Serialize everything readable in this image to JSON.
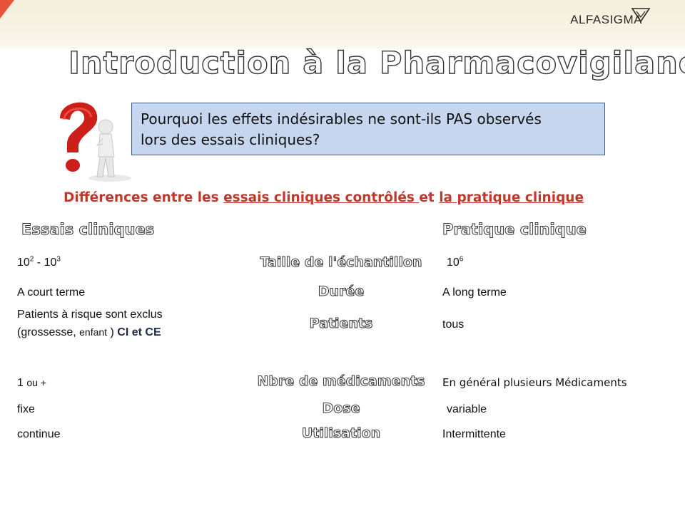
{
  "header": {
    "logo_text": "ALFASIGMA",
    "logo_icon": "alfasigma-triangle-icon"
  },
  "title": "Introduction à la Pharmacovigilance",
  "question": {
    "icon": "question-mark-figure-icon",
    "line1": "Pourquoi les effets indésirables ne sont-ils PAS observés",
    "line2": "lors des essais cliniques?"
  },
  "subtitle": {
    "part1": "Différences entre les ",
    "part2": "essais cliniques contrôlés ",
    "part3": "et ",
    "part4": "la pratique clinique"
  },
  "table": {
    "left_header": "Essais cliniques",
    "right_header": "Pratique clinique",
    "rows": [
      {
        "criterion": "Taille de l'échantillon",
        "left_base1": "10",
        "left_exp1": "2",
        "left_sep": " - ",
        "left_base2": "10",
        "left_exp2": "3",
        "right_base": "10",
        "right_exp": "6"
      },
      {
        "criterion": "Durée",
        "left": "A court terme",
        "right": "A long terme"
      },
      {
        "criterion": "Patients",
        "left_line1": "Patients à risque sont exclus",
        "left_line2_a": "(grossesse",
        "left_line2_b": ", ",
        "left_line2_c": "enfant",
        "left_line2_d": " ) ",
        "left_line2_e": "CI et CE",
        "right": "tous"
      },
      {
        "criterion": "Nbre de médicaments",
        "left_a": "1 ",
        "left_b": "ou +",
        "right": "En général plusieurs Médicaments"
      },
      {
        "criterion": "Dose",
        "left": "fixe",
        "right": "variable"
      },
      {
        "criterion": "Utilisation",
        "left": "continue",
        "right": "Intermittente"
      }
    ]
  }
}
